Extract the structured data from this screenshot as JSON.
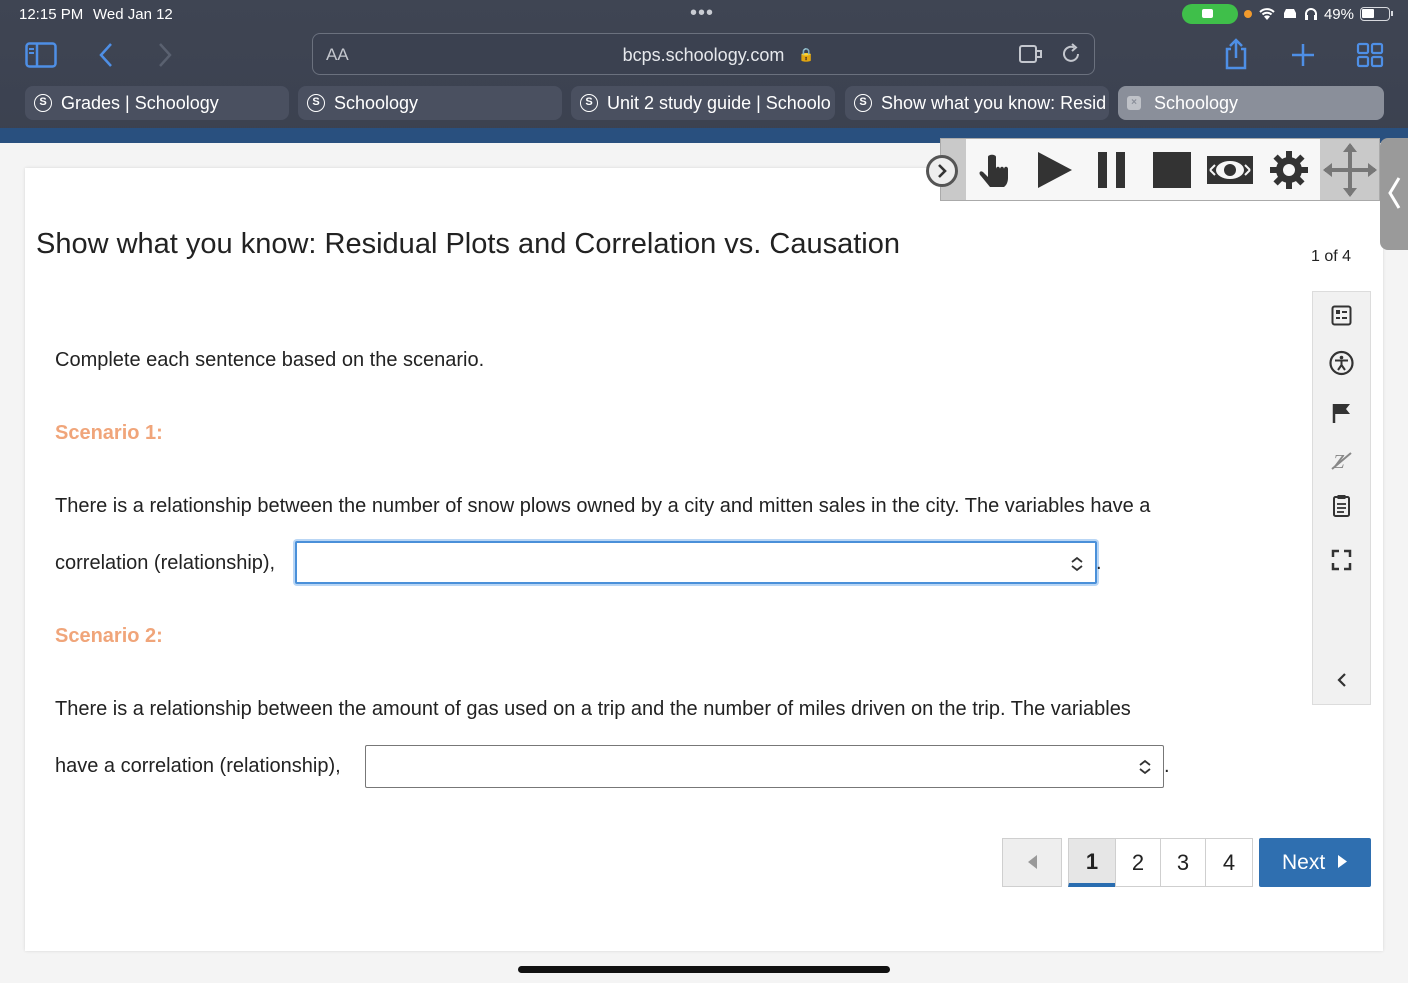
{
  "status_bar": {
    "time": "12:15 PM",
    "date": "Wed Jan 12",
    "battery": "49%"
  },
  "browser": {
    "text_size_label": "AA",
    "url": "bcps.schoology.com",
    "tabs": [
      {
        "label": "Grades | Schoology",
        "favicon": "S"
      },
      {
        "label": "Schoology",
        "favicon": "S"
      },
      {
        "label": "Unit 2 study guide | Schoolo",
        "favicon": "S"
      },
      {
        "label": "Show what you know: Resid",
        "favicon": "S"
      },
      {
        "label": "Schoology",
        "favicon": "×"
      }
    ]
  },
  "page": {
    "title": "Show what you know: Residual Plots and Correlation vs. Causation",
    "counter": "1 of 4",
    "instructions": "Complete each sentence based on the scenario.",
    "scenarios": [
      {
        "heading": "Scenario 1:",
        "line1": "There is a relationship between the number of snow plows owned by a city and mitten sales in the city. The variables have a",
        "line2": "correlation (relationship),",
        "selected": "",
        "end": "."
      },
      {
        "heading": "Scenario 2:",
        "line1": "There is a relationship between the amount of gas used on a trip and the number of miles driven on the trip. The variables",
        "line2": "have a correlation (relationship),",
        "selected": "",
        "end": "."
      }
    ]
  },
  "pagination": {
    "pages": [
      "1",
      "2",
      "3",
      "4"
    ],
    "current": "1",
    "next_label": "Next"
  },
  "colors": {
    "accent": "#2f6fb0",
    "scenario_heading": "#f0a57a",
    "focus_ring": "#4a90d9"
  }
}
